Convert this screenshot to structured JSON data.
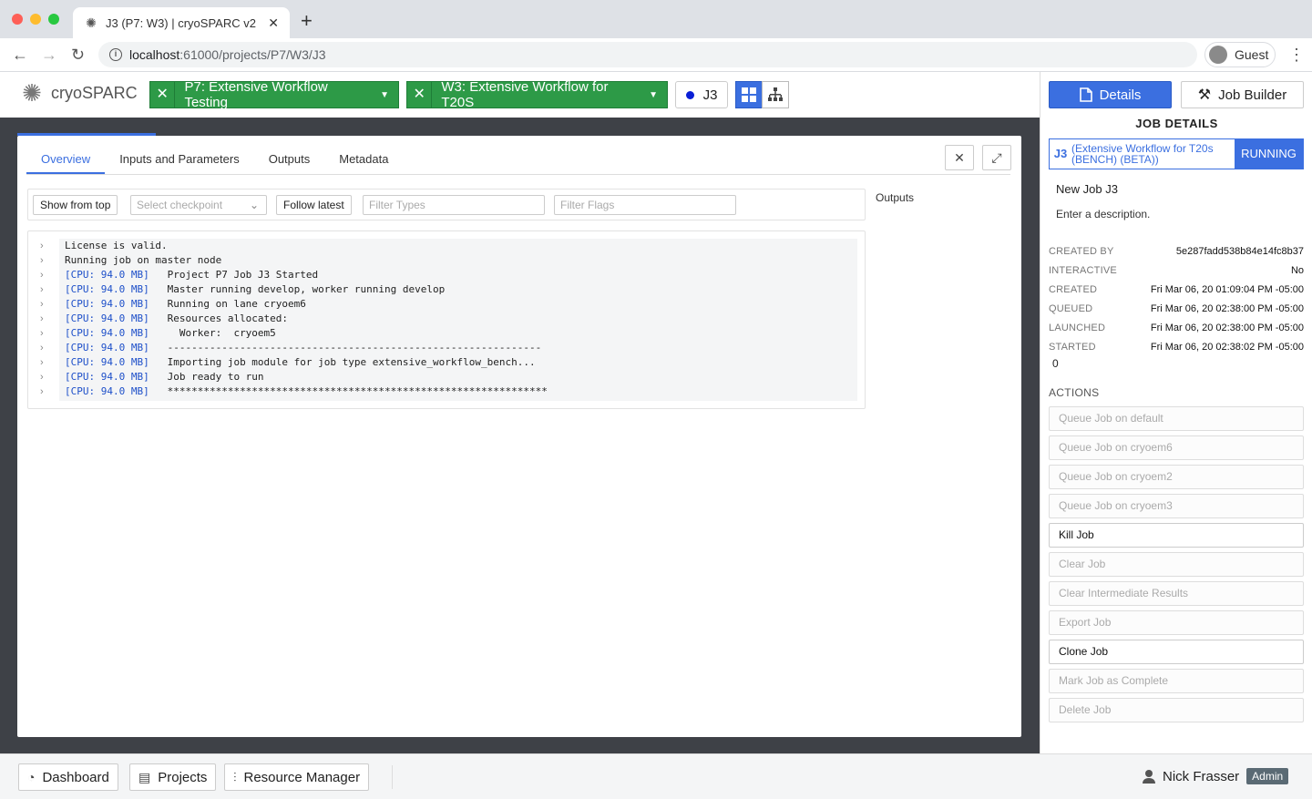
{
  "browser": {
    "tab_title": "J3 (P7: W3) | cryoSPARC v2",
    "url_host": "localhost",
    "url_path": ":61000/projects/P7/W3/J3",
    "profile": "Guest"
  },
  "header": {
    "logo_text": "cryoSPARC",
    "project_crumb": "P7: Extensive Workflow Testing",
    "workspace_crumb": "W3: Extensive Workflow for T20S",
    "job_crumb": "J3"
  },
  "tabs": [
    "Overview",
    "Inputs and Parameters",
    "Outputs",
    "Metadata"
  ],
  "filters": {
    "show_from_top": "Show from top",
    "select_checkpoint": "Select checkpoint",
    "follow_latest": "Follow latest",
    "filter_types": "Filter Types",
    "filter_flags": "Filter Flags"
  },
  "outputs_label": "Outputs",
  "log": [
    {
      "prefix": "",
      "text": "License is valid."
    },
    {
      "prefix": "",
      "text": "Running job on master node"
    },
    {
      "prefix": "[CPU: 94.0 MB]",
      "text": "Project P7 Job J3 Started"
    },
    {
      "prefix": "[CPU: 94.0 MB]",
      "text": "Master running develop, worker running develop"
    },
    {
      "prefix": "[CPU: 94.0 MB]",
      "text": "Running on lane cryoem6"
    },
    {
      "prefix": "[CPU: 94.0 MB]",
      "text": "Resources allocated:"
    },
    {
      "prefix": "[CPU: 94.0 MB]",
      "text": "  Worker:  cryoem5"
    },
    {
      "prefix": "[CPU: 94.0 MB]",
      "text": "--------------------------------------------------------------"
    },
    {
      "prefix": "[CPU: 94.0 MB]",
      "text": "Importing job module for job type extensive_workflow_bench..."
    },
    {
      "prefix": "[CPU: 94.0 MB]",
      "text": "Job ready to run"
    },
    {
      "prefix": "[CPU: 94.0 MB]",
      "text": "***************************************************************"
    }
  ],
  "panel": {
    "details_btn": "Details",
    "builder_btn": "Job Builder",
    "title": "JOB DETAILS",
    "job_id": "J3",
    "job_type": "(Extensive Workflow for T20s (BENCH) (BETA))",
    "status": "RUNNING",
    "job_name": "New Job J3",
    "description": "Enter a description.",
    "meta": [
      {
        "k": "CREATED BY",
        "v": "5e287fadd538b84e14fc8b37"
      },
      {
        "k": "INTERACTIVE",
        "v": "No"
      },
      {
        "k": "CREATED",
        "v": "Fri Mar 06, 20 01:09:04 PM -05:00"
      },
      {
        "k": "QUEUED",
        "v": "Fri Mar 06, 20 02:38:00 PM -05:00"
      },
      {
        "k": "LAUNCHED",
        "v": "Fri Mar 06, 20 02:38:00 PM -05:00"
      },
      {
        "k": "STARTED",
        "v": "Fri Mar 06, 20 02:38:02 PM -05:00"
      }
    ],
    "started_extra": "0",
    "actions_title": "ACTIONS",
    "actions": [
      {
        "label": "Queue Job on default",
        "enabled": false
      },
      {
        "label": "Queue Job on cryoem6",
        "enabled": false
      },
      {
        "label": "Queue Job on cryoem2",
        "enabled": false
      },
      {
        "label": "Queue Job on cryoem3",
        "enabled": false
      },
      {
        "label": "Kill Job",
        "enabled": true
      },
      {
        "label": "Clear Job",
        "enabled": false
      },
      {
        "label": "Clear Intermediate Results",
        "enabled": false
      },
      {
        "label": "Export Job",
        "enabled": false
      },
      {
        "label": "Clone Job",
        "enabled": true
      },
      {
        "label": "Mark Job as Complete",
        "enabled": false
      },
      {
        "label": "Delete Job",
        "enabled": false
      }
    ]
  },
  "bottom": {
    "dashboard": "Dashboard",
    "projects": "Projects",
    "resource_manager": "Resource Manager",
    "user": "Nick Frasser",
    "role": "Admin"
  }
}
